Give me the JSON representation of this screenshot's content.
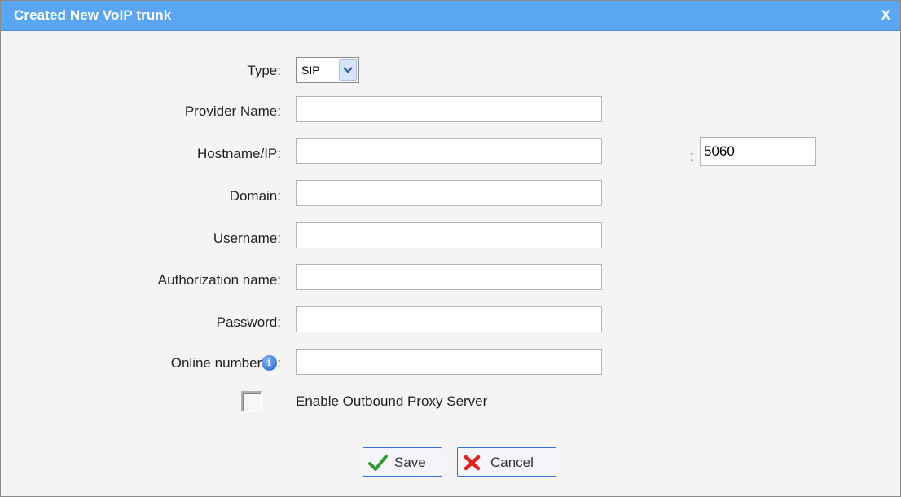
{
  "dialog": {
    "title": "Created New VoIP trunk",
    "close_label": "X"
  },
  "form": {
    "type_label": "Type:",
    "type_value": "SIP",
    "provider_name_label": "Provider Name:",
    "provider_name_value": "",
    "hostname_label": "Hostname/IP:",
    "hostname_value": "",
    "port_separator": ":",
    "port_value": "5060",
    "domain_label": "Domain:",
    "domain_value": "",
    "username_label": "Username:",
    "username_value": "",
    "authorization_label": "Authorization name:",
    "authorization_value": "",
    "password_label": "Password:",
    "password_value": "",
    "online_number_label": "Online number",
    "online_number_colon": ":",
    "online_number_value": "",
    "info_glyph": "i",
    "proxy_label": "Enable Outbound Proxy Server",
    "proxy_checked": false
  },
  "buttons": {
    "save_label": "Save",
    "cancel_label": "Cancel"
  },
  "colors": {
    "titlebar": "#5aa6f2",
    "accent_border": "#3b6fd6"
  }
}
